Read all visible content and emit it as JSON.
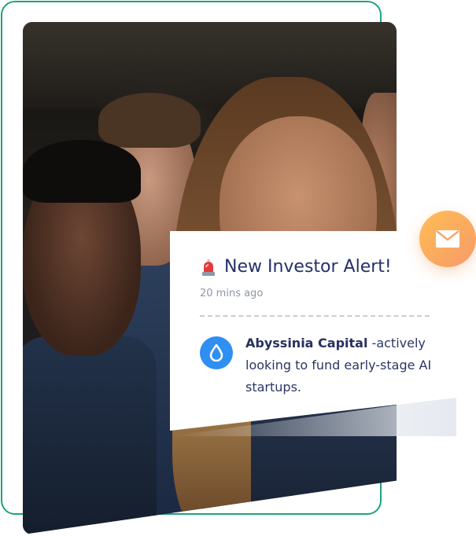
{
  "notification": {
    "title": "New Investor Alert!",
    "time": "20 mins ago",
    "company": "Abyssinia Capital",
    "message": " -actively looking to fund early-stage AI startups.",
    "alert_icon": "siren-icon",
    "company_icon": "water-drop-icon"
  },
  "badge": {
    "icon": "mail-icon"
  },
  "colors": {
    "frame": "#1fa37e",
    "title": "#25306b",
    "drop_icon_bg": "#2f8ff3",
    "badge_from": "#ffbd54",
    "badge_to": "#f79a6a"
  }
}
